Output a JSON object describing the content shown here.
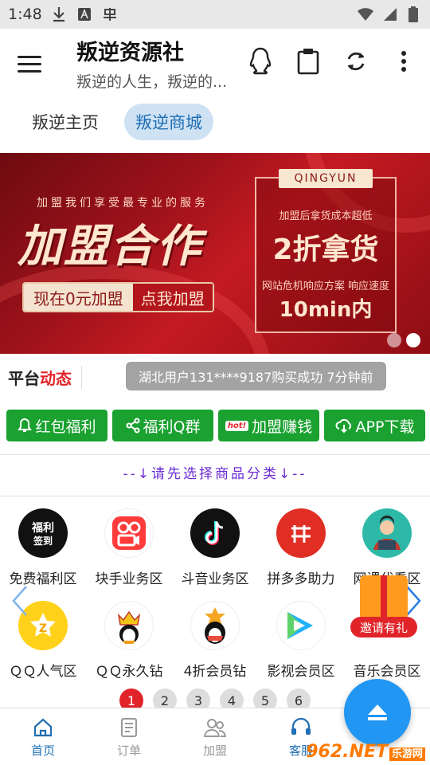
{
  "status_bar": {
    "time": "1:48"
  },
  "app_bar": {
    "title": "叛逆资源社",
    "subtitle": "叛逆的人生，叛逆的..."
  },
  "tabs": [
    {
      "label": "叛逆主页"
    },
    {
      "label": "叛逆商城"
    }
  ],
  "banner": {
    "service_line": "加盟我们享受最专业的服务",
    "headline": "加盟合作",
    "cta_left": "现在0元加盟",
    "cta_right": "点我加盟",
    "box_tag": "QINGYUN",
    "box_line1": "加盟后拿货成本超低",
    "box_line2": "2折拿货",
    "box_line3": "网站危机响应方案 响应速度",
    "box_line4": "10min内"
  },
  "news": {
    "label_black": "平台",
    "label_red": "动态",
    "message": "湖北用户131****9187购买成功 7分钟前"
  },
  "quick_links": [
    {
      "label": "红包福利"
    },
    {
      "label": "福利Q群"
    },
    {
      "label": "加盟赚钱",
      "badge": "hot!"
    },
    {
      "label": "APP下载"
    }
  ],
  "category_tip": "--↓请先选择商品分类↓--",
  "categories_row1": [
    {
      "label": "免费福利区",
      "icon_text": "福利 签到"
    },
    {
      "label": "块手业务区"
    },
    {
      "label": "斗音业务区"
    },
    {
      "label": "拼多多助力"
    },
    {
      "label": "网课代看区"
    }
  ],
  "categories_row2": [
    {
      "label": "ＱＱ人气区"
    },
    {
      "label": "ＱＱ永久钻"
    },
    {
      "label": "4折会员钻"
    },
    {
      "label": "影视会员区"
    },
    {
      "label": "音乐会员区"
    }
  ],
  "invite": {
    "label": "邀请有礼"
  },
  "pager": [
    "1",
    "2",
    "3",
    "4",
    "5",
    "6"
  ],
  "bottom_nav": [
    {
      "label": "首页"
    },
    {
      "label": "订单"
    },
    {
      "label": "加盟"
    },
    {
      "label": "客服"
    }
  ],
  "watermark": {
    "text": "962.NET",
    "sub": "乐游网"
  },
  "colors": {
    "accent": "#1e6fb5",
    "green": "#1aa130",
    "red": "#e0242a",
    "fab": "#2196f3"
  }
}
